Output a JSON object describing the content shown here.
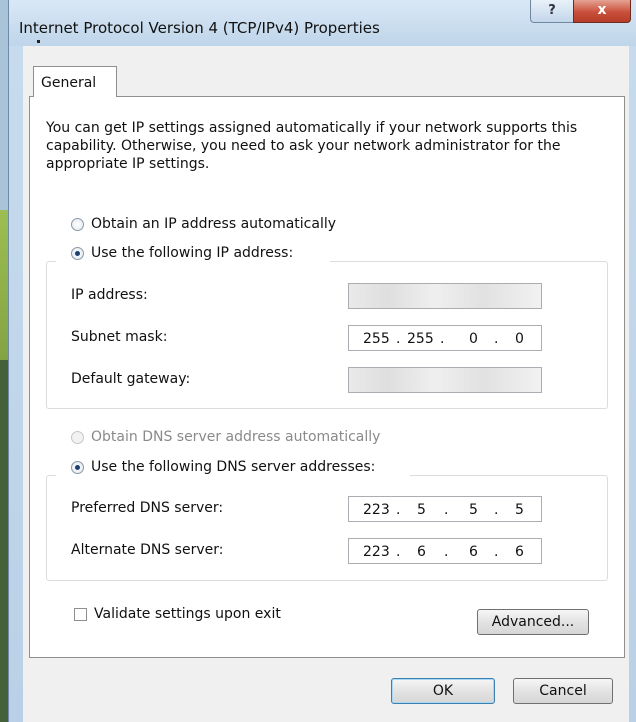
{
  "window": {
    "title": "Internet Protocol Version 4 (TCP/IPv4) Properties",
    "help_label": "?",
    "close_label": "x"
  },
  "tabs": [
    {
      "label": "General"
    }
  ],
  "general": {
    "description": "You can get IP settings assigned automatically if your network supports this capability. Otherwise, you need to ask your network administrator for the appropriate IP settings.",
    "ip_auto_label": "Obtain an IP address automatically",
    "ip_manual_label": "Use the following IP address:",
    "ip_mode": "manual",
    "fields": {
      "ip_address": {
        "label": "IP address:",
        "value": "",
        "obscured": true
      },
      "subnet_mask": {
        "label": "Subnet mask:",
        "octets": [
          "255",
          "255",
          "0",
          "0"
        ]
      },
      "default_gateway": {
        "label": "Default gateway:",
        "value": "",
        "obscured": true
      }
    },
    "dns_auto_label": "Obtain DNS server address automatically",
    "dns_auto_enabled": false,
    "dns_manual_label": "Use the following DNS server addresses:",
    "dns_mode": "manual",
    "dns": {
      "preferred": {
        "label": "Preferred DNS server:",
        "octets": [
          "223",
          "5",
          "5",
          "5"
        ]
      },
      "alternate": {
        "label": "Alternate DNS server:",
        "octets": [
          "223",
          "6",
          "6",
          "6"
        ]
      }
    },
    "validate_label": "Validate settings upon exit",
    "validate_checked": false,
    "advanced_label": "Advanced..."
  },
  "buttons": {
    "ok": "OK",
    "cancel": "Cancel"
  },
  "colors": {
    "title_bar": "#c8dcee",
    "close_button": "#c9503a",
    "default_button_border": "#3c7fb1"
  }
}
